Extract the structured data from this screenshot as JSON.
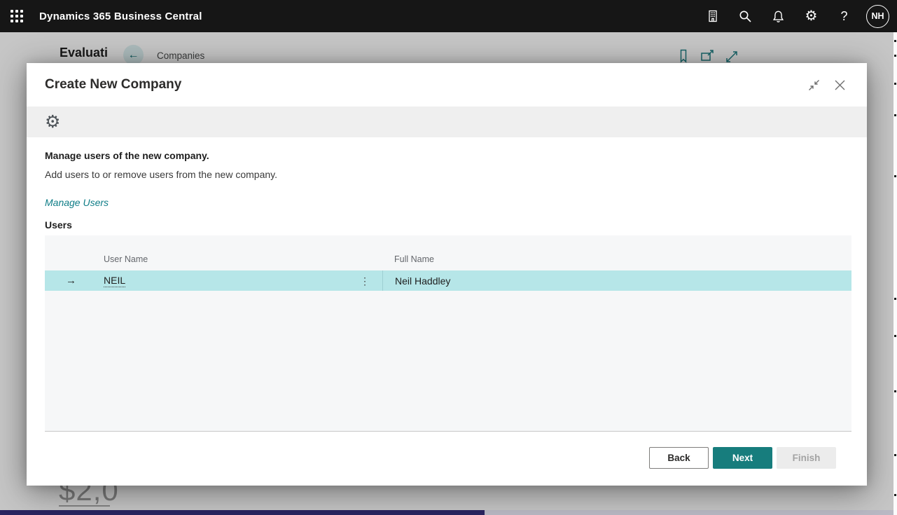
{
  "topbar": {
    "app_title": "Dynamics 365 Business Central",
    "avatar_initials": "NH"
  },
  "background": {
    "company_badge": "Evaluati",
    "breadcrumb": "Companies",
    "kpi_value": "$2,0"
  },
  "dialog": {
    "title": "Create New Company",
    "step_heading": "Manage users of the new company.",
    "step_description": "Add users to or remove users from the new company.",
    "manage_users_link": "Manage Users",
    "users_section_label": "Users",
    "table": {
      "columns": [
        "User Name",
        "Full Name"
      ],
      "rows": [
        {
          "user_name": "NEIL",
          "full_name": "Neil Haddley"
        }
      ]
    },
    "buttons": {
      "back": "Back",
      "next": "Next",
      "finish": "Finish"
    }
  },
  "icons": {
    "gear_glyph": "⚙",
    "help_glyph": "?",
    "back_arrow_glyph": "←",
    "row_arrow_glyph": "→",
    "ellipsis_glyph": "⋮"
  },
  "colors": {
    "topbar_bg": "#161616",
    "accent_teal": "#177d7d",
    "link_teal": "#0f7d87",
    "row_highlight": "#b6e6e8",
    "bottom_bar_indigo": "#352e78",
    "toolbar_gray": "#efefef"
  }
}
